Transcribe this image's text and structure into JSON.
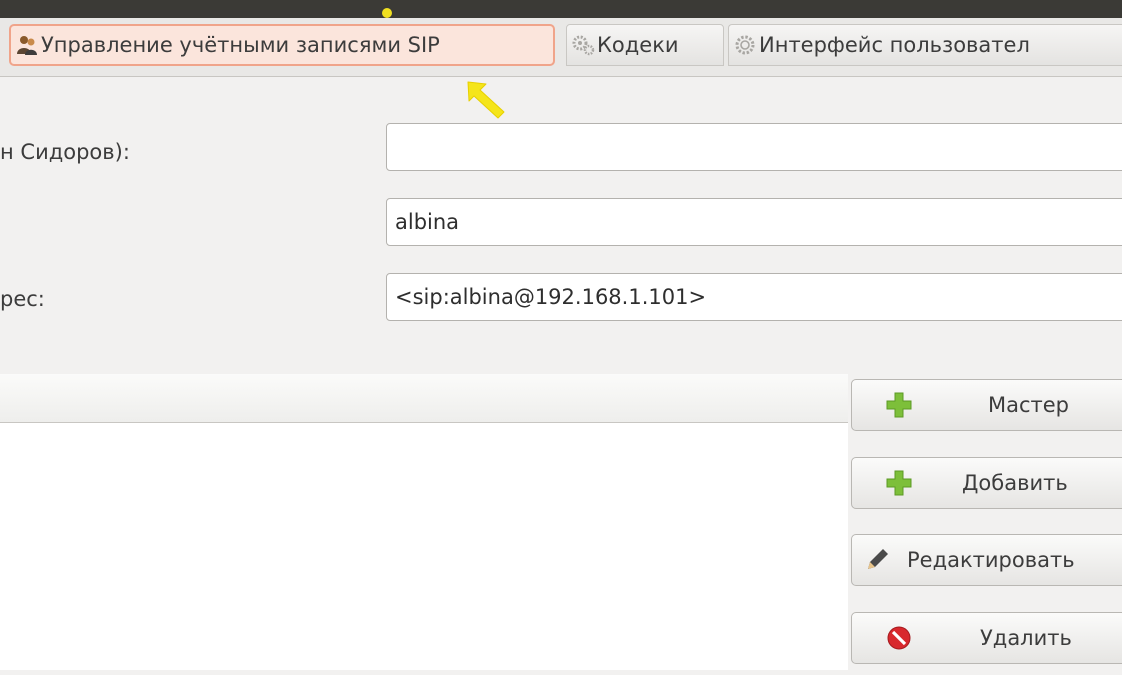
{
  "tabs": [
    {
      "label": "Управление учётными записями SIP",
      "icon": "users-icon",
      "active": true
    },
    {
      "label": "Кодеки",
      "icon": "gears-icon",
      "active": false
    },
    {
      "label": "Интерфейс пользовател",
      "icon": "gear-icon",
      "active": false
    }
  ],
  "form": {
    "display_name_label": "н Сидоров):",
    "display_name_value": "",
    "username_value": "albina",
    "address_label": "рес:",
    "address_value": "<sip:albina@192.168.1.101>"
  },
  "buttons": {
    "wizard": "Мастер",
    "add": "Добавить",
    "edit": "Редактировать",
    "delete": "Удалить"
  },
  "colors": {
    "active_tab_bg": "#fbe5dc",
    "active_tab_border": "#f0a48a",
    "cursor": "#f5e51a",
    "plus_green": "#7dbf3a",
    "delete_red": "#d8282d"
  }
}
